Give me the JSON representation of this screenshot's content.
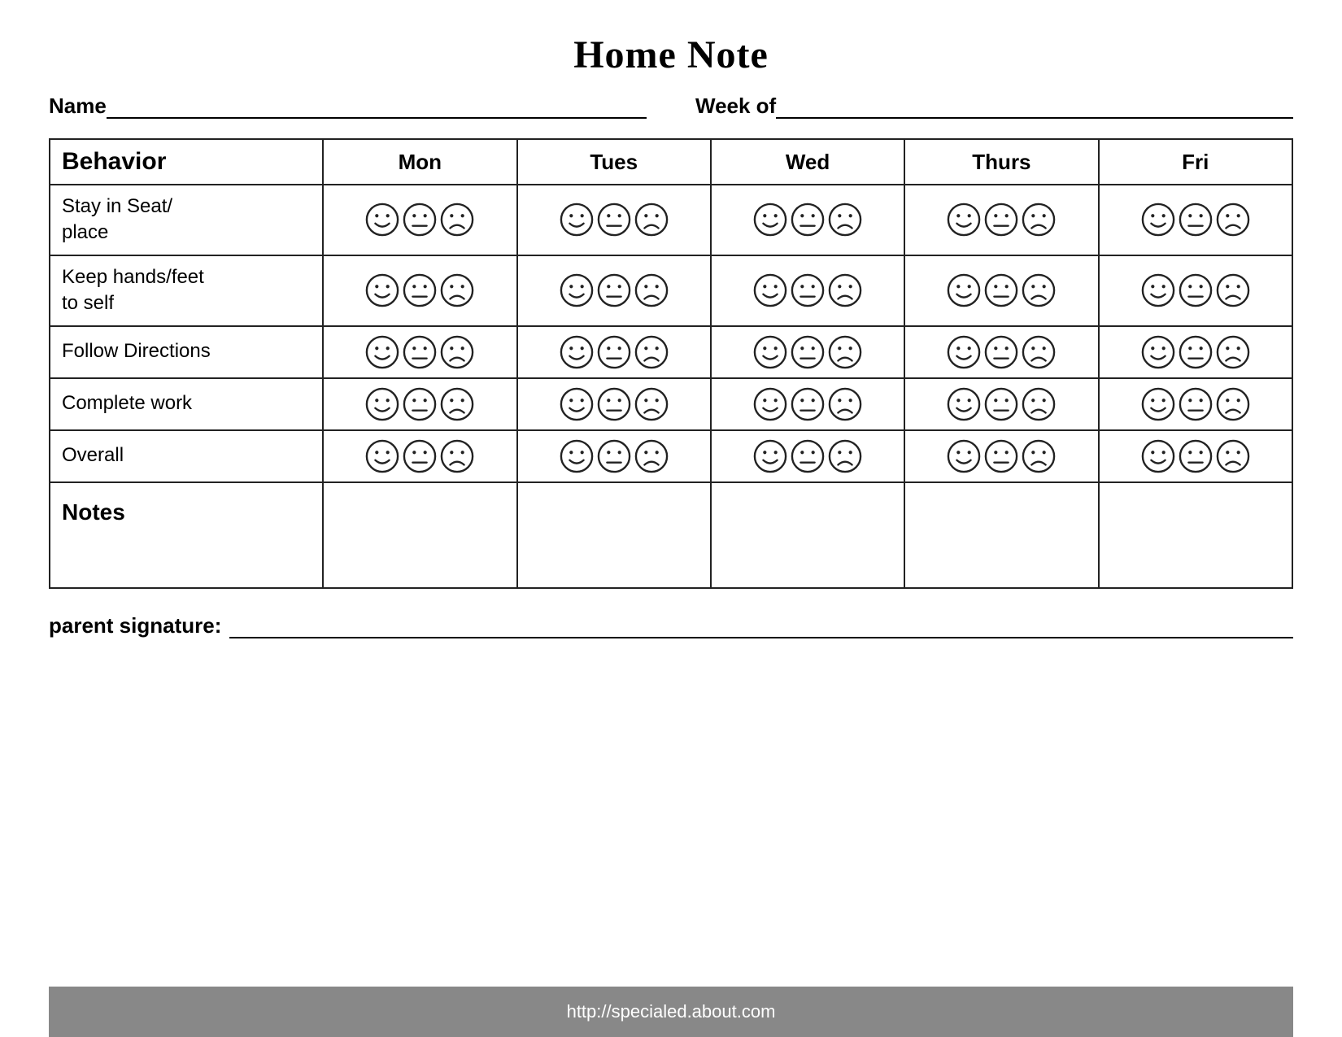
{
  "title": "Home Note",
  "name_label": "Name",
  "weekof_label": "Week of",
  "table": {
    "headers": [
      "Behavior",
      "Mon",
      "Tues",
      "Wed",
      "Thurs",
      "Fri"
    ],
    "rows": [
      {
        "label": "Stay in Seat/\nplace"
      },
      {
        "label": "Keep hands/feet\nto self"
      },
      {
        "label": "Follow Directions"
      },
      {
        "label": "Complete work"
      },
      {
        "label": "Overall"
      },
      {
        "label": "Notes",
        "is_notes": true
      }
    ]
  },
  "signature_label": "parent signature:",
  "footer_url": "http://specialed.about.com"
}
